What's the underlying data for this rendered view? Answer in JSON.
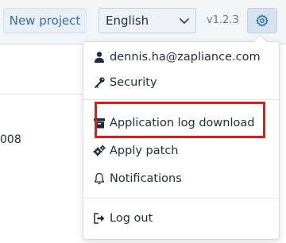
{
  "toolbar": {
    "new_project_label": "New project",
    "language_selected": "English",
    "version": "v1.2.3"
  },
  "background": {
    "partial_text": "008"
  },
  "menu": {
    "items": [
      {
        "label": "dennis.ha@zapliance.com",
        "icon": "user-icon"
      },
      {
        "label": "Security",
        "icon": "key-icon"
      },
      {
        "label": "Application log download",
        "icon": "archive-icon"
      },
      {
        "label": "Apply patch",
        "icon": "cogs-icon"
      },
      {
        "label": "Notifications",
        "icon": "bell-icon"
      },
      {
        "label": "Log out",
        "icon": "sign-out-icon"
      }
    ]
  },
  "colors": {
    "accent": "#2f6fae",
    "highlight": "#e01b1b"
  }
}
